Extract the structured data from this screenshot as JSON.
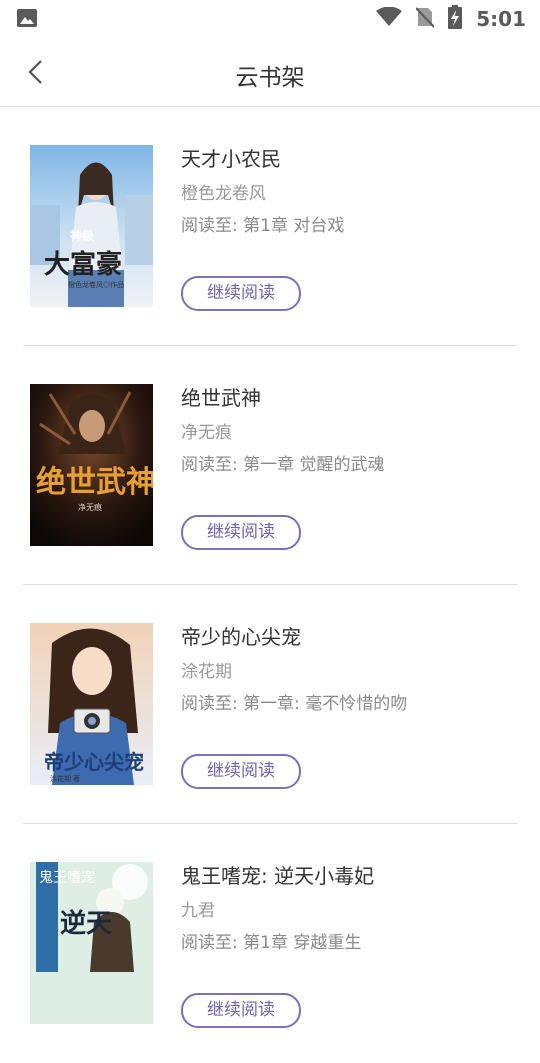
{
  "status_bar": {
    "time": "5:01",
    "icons": [
      "image-icon",
      "wifi-icon",
      "no-sim-icon",
      "battery-charging-icon"
    ]
  },
  "nav": {
    "title": "云书架",
    "back_icon": "chevron-left-icon"
  },
  "books": [
    {
      "title": "天才小农民",
      "author": "橙色龙卷风",
      "progress": "阅读至: 第1章 对台戏",
      "button": "继续阅读",
      "cover_text": [
        "神级",
        "大富豪",
        "橙色龙卷风◎作品"
      ]
    },
    {
      "title": "绝世武神",
      "author": "净无痕",
      "progress": "阅读至: 第一章 觉醒的武魂",
      "button": "继续阅读",
      "cover_text": [
        "绝世武神",
        "净无痕"
      ]
    },
    {
      "title": "帝少的心尖宠",
      "author": "涂花期",
      "progress": "阅读至: 第一章:  毫不怜惜的吻",
      "button": "继续阅读",
      "cover_text": [
        "帝少心尖宠",
        "涂花期 著"
      ]
    },
    {
      "title": "鬼王嗜宠: 逆天小毒妃",
      "author": "九君",
      "progress": "阅读至: 第1章 穿越重生",
      "button": "继续阅读",
      "cover_text": [
        "鬼王嗜宠",
        "逆天"
      ]
    }
  ],
  "colors": {
    "accent": "#7b6fc0",
    "title": "#333333",
    "secondary": "#9a9a9a",
    "divider": "#dcdcdc"
  }
}
